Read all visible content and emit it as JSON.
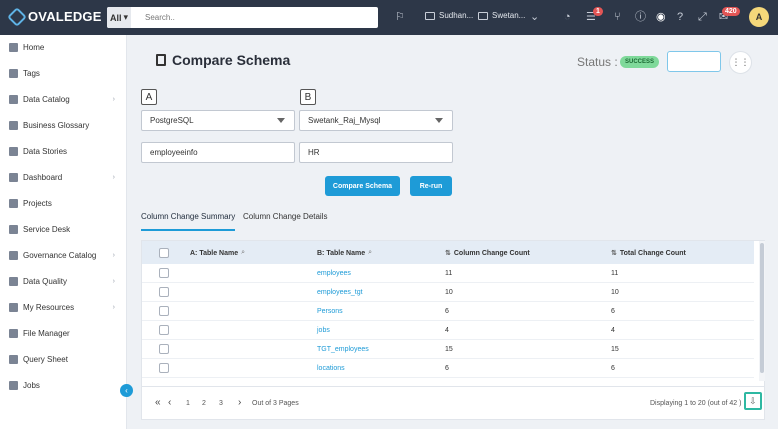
{
  "topbar": {
    "brand": "OVALEDGE",
    "search_scope": "All",
    "search_placeholder": "Search..",
    "folders": [
      "Sudhan...",
      "Swetan..."
    ],
    "notif_badge_1": "1",
    "notif_badge_2": "420",
    "avatar_initial": "A"
  },
  "sidebar": {
    "items": [
      {
        "label": "Home",
        "has_chevron": false
      },
      {
        "label": "Tags",
        "has_chevron": false
      },
      {
        "label": "Data Catalog",
        "has_chevron": true
      },
      {
        "label": "Business Glossary",
        "has_chevron": false
      },
      {
        "label": "Data Stories",
        "has_chevron": false
      },
      {
        "label": "Dashboard",
        "has_chevron": true
      },
      {
        "label": "Projects",
        "has_chevron": false
      },
      {
        "label": "Service Desk",
        "has_chevron": false
      },
      {
        "label": "Governance Catalog",
        "has_chevron": true
      },
      {
        "label": "Data Quality",
        "has_chevron": true
      },
      {
        "label": "My Resources",
        "has_chevron": true
      },
      {
        "label": "File Manager",
        "has_chevron": false
      },
      {
        "label": "Query Sheet",
        "has_chevron": false
      },
      {
        "label": "Jobs",
        "has_chevron": false
      }
    ]
  },
  "page": {
    "title": "Compare Schema",
    "status_label": "Status :",
    "status_value": "SUCCESS"
  },
  "compare": {
    "a_tag": "A",
    "b_tag": "B",
    "a_connection": "PostgreSQL",
    "b_connection": "Swetank_Raj_Mysql",
    "a_schema": "employeeinfo",
    "b_schema": "HR",
    "compare_button": "Compare Schema",
    "rerun_button": "Re-run"
  },
  "tabs": [
    "Column Change Summary",
    "Column Change Details"
  ],
  "table": {
    "headers": {
      "a_table": "A: Table Name",
      "b_table": "B: Table Name",
      "column_change": "Column Change Count",
      "total_change": "Total Change Count"
    },
    "rows": [
      {
        "a": "",
        "b": "employees",
        "column": "11",
        "total": "11"
      },
      {
        "a": "",
        "b": "employees_tgt",
        "column": "10",
        "total": "10"
      },
      {
        "a": "",
        "b": "Persons",
        "column": "6",
        "total": "6"
      },
      {
        "a": "",
        "b": "jobs",
        "column": "4",
        "total": "4"
      },
      {
        "a": "",
        "b": "TGT_employees",
        "column": "15",
        "total": "15"
      },
      {
        "a": "",
        "b": "locations",
        "column": "6",
        "total": "6"
      }
    ]
  },
  "pager": {
    "pages": [
      "1",
      "2",
      "3"
    ],
    "out_of": "Out of 3 Pages",
    "displaying": "Displaying 1 to 20 (out of  42 )"
  }
}
